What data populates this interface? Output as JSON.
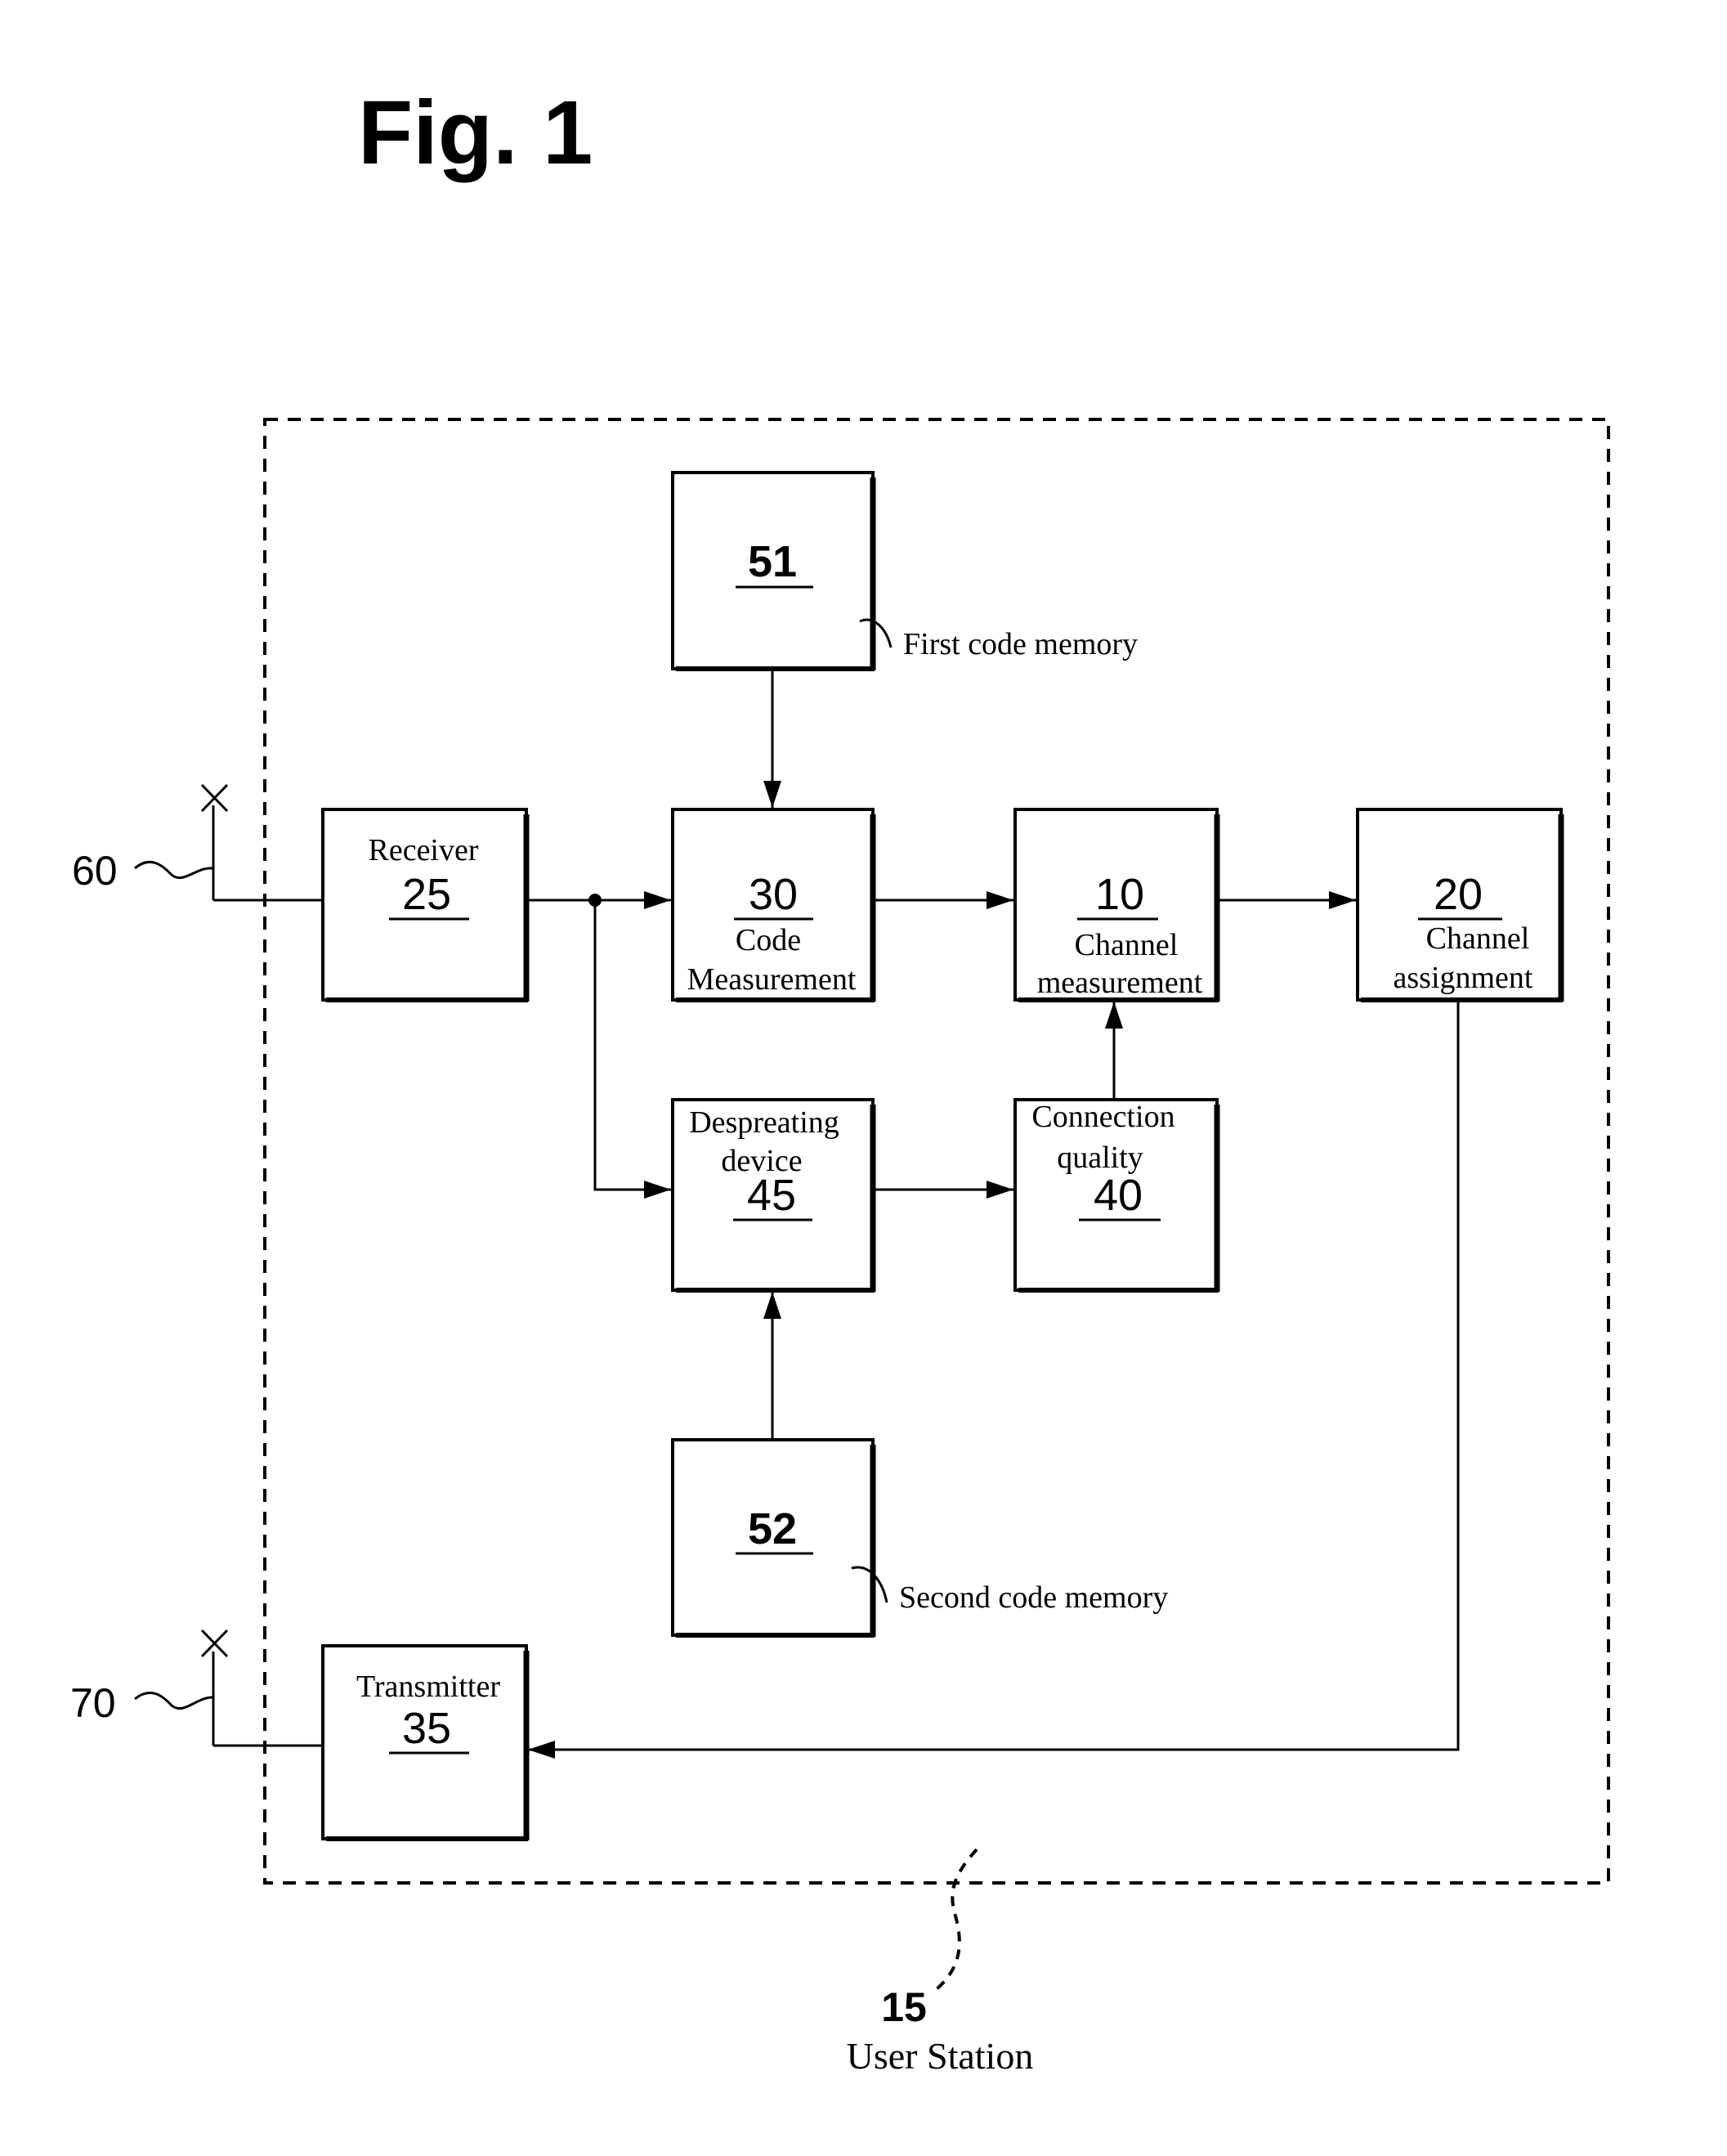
{
  "figure": {
    "title": "Fig. 1",
    "enclosure": {
      "ref": "15",
      "label": "User Station"
    }
  },
  "blocks": {
    "first_code_memory": {
      "ref": "51",
      "callout": "First code memory"
    },
    "receiver": {
      "ref": "25",
      "label_lines": [
        "Receiver"
      ]
    },
    "code_measurement": {
      "ref": "30",
      "label_lines": [
        "Code",
        "Measurement"
      ]
    },
    "channel_measurement": {
      "ref": "10",
      "label_lines": [
        "Channel",
        "measurement"
      ]
    },
    "channel_assignment": {
      "ref": "20",
      "label_lines": [
        "Channel",
        "assignment"
      ]
    },
    "despreading_device": {
      "ref": "45",
      "label_lines": [
        "Despreating",
        "device"
      ]
    },
    "connection_quality": {
      "ref": "40",
      "label_lines": [
        "Connection",
        "quality"
      ]
    },
    "second_code_memory": {
      "ref": "52",
      "callout": "Second code memory"
    },
    "transmitter": {
      "ref": "35",
      "label_lines": [
        "Transmitter"
      ]
    }
  },
  "antennas": {
    "receive": {
      "ref": "60"
    },
    "transmit": {
      "ref": "70"
    }
  },
  "connections": [
    {
      "from": "receive_antenna",
      "to": "receiver"
    },
    {
      "from": "receiver",
      "to": "code_measurement"
    },
    {
      "from": "receiver",
      "to": "despreading_device"
    },
    {
      "from": "first_code_memory",
      "to": "code_measurement"
    },
    {
      "from": "code_measurement",
      "to": "channel_measurement"
    },
    {
      "from": "channel_measurement",
      "to": "channel_assignment"
    },
    {
      "from": "second_code_memory",
      "to": "despreading_device"
    },
    {
      "from": "despreading_device",
      "to": "connection_quality"
    },
    {
      "from": "connection_quality",
      "to": "channel_measurement"
    },
    {
      "from": "channel_assignment",
      "to": "transmitter"
    },
    {
      "from": "transmitter",
      "to": "transmit_antenna"
    }
  ]
}
